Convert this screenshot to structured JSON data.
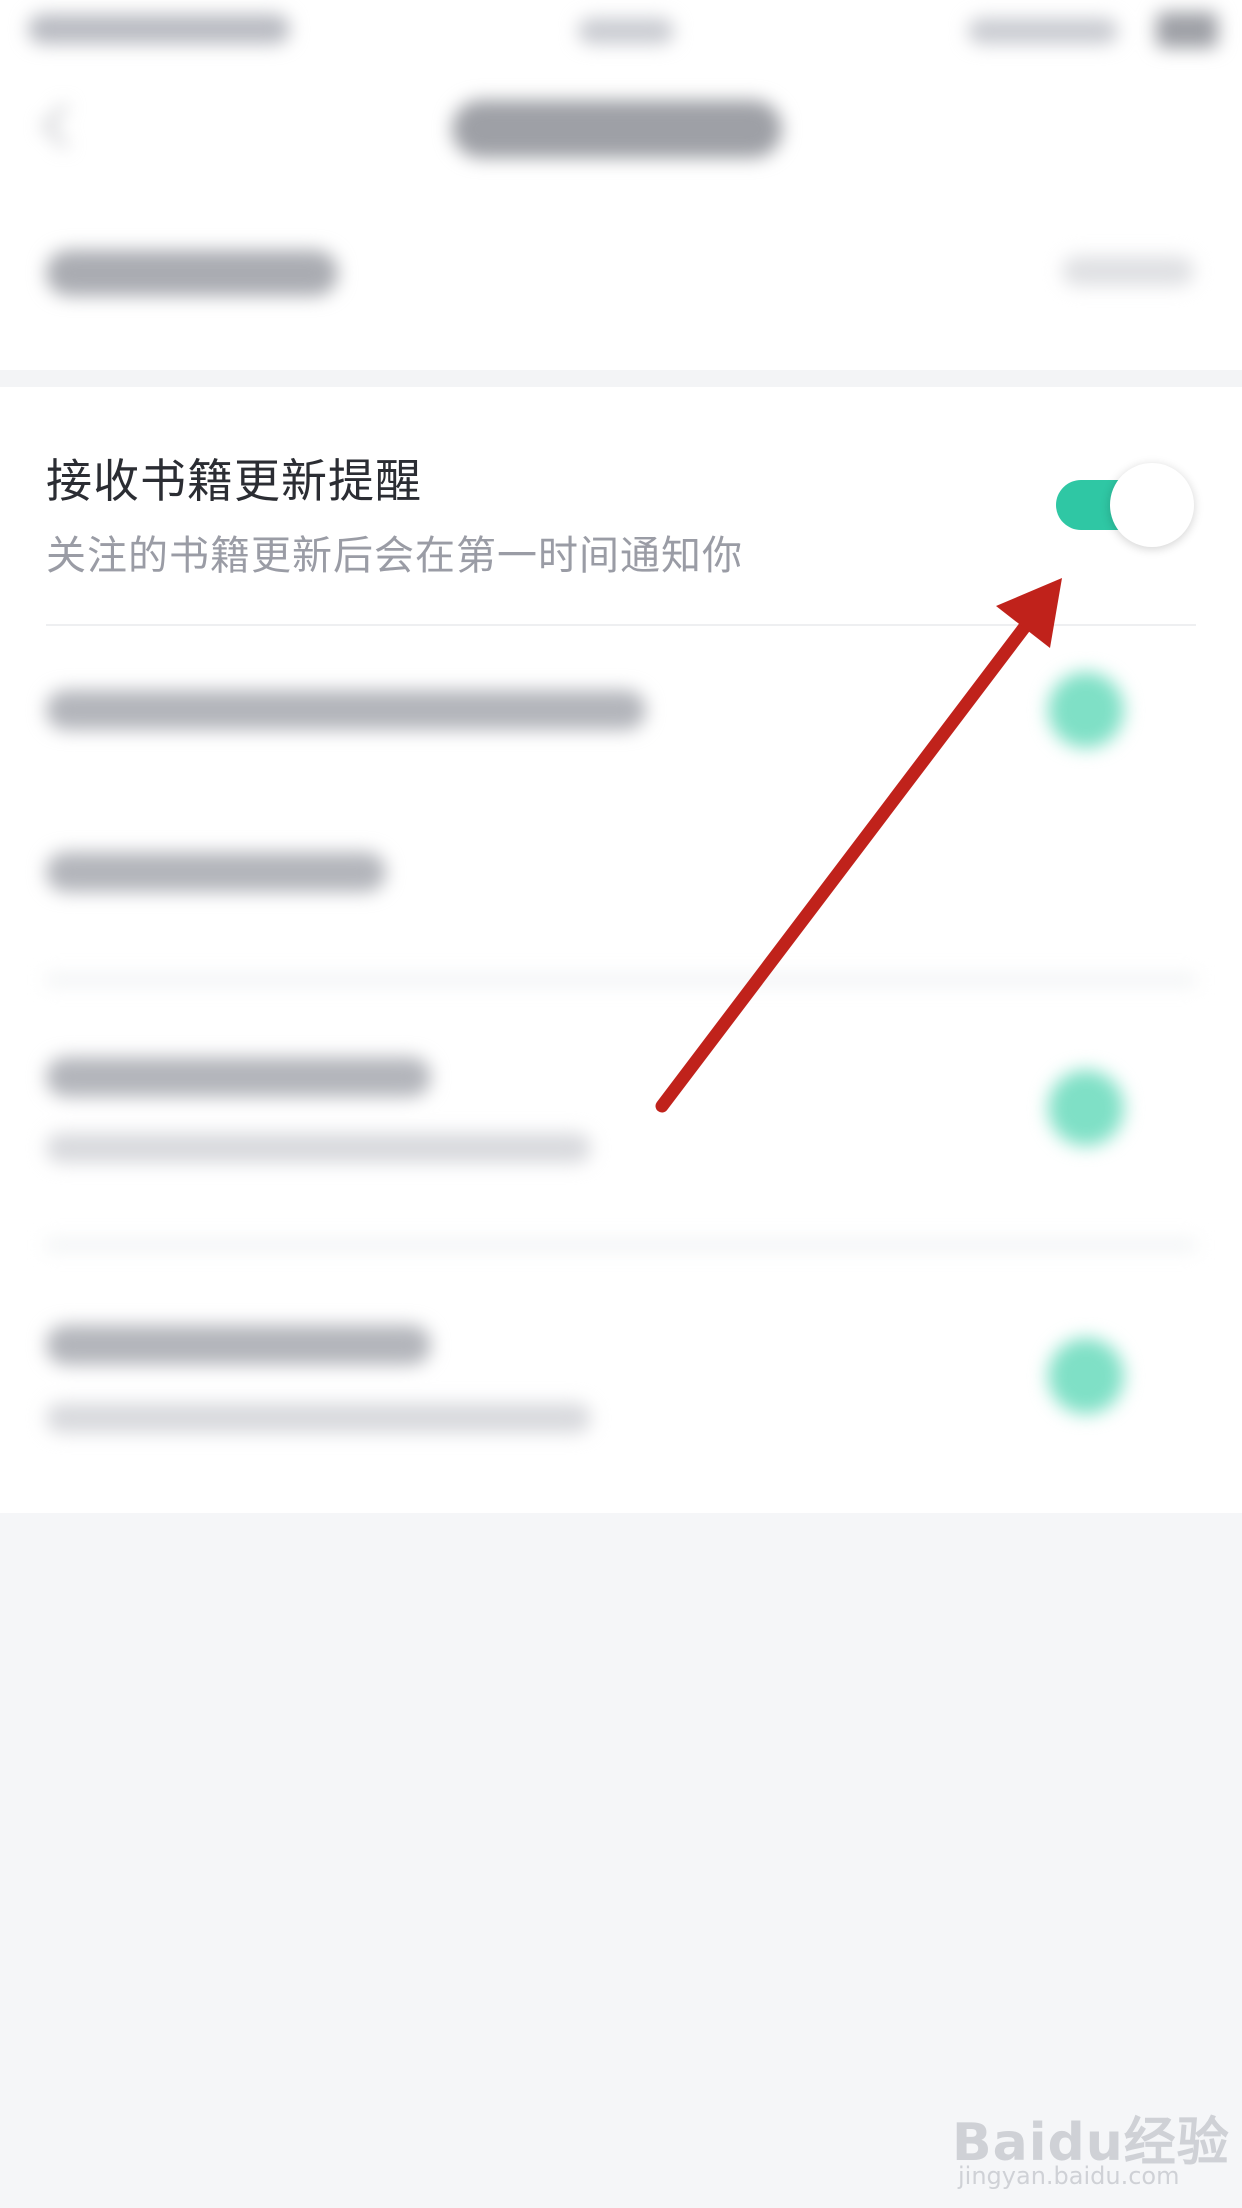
{
  "setting": {
    "title": "接收书籍更新提醒",
    "subtitle": "关注的书籍更新后会在第一时间通知你",
    "toggle_on": true
  },
  "colors": {
    "accent": "#2fc7a4",
    "arrow": "#c0221b",
    "background": "#f5f6f8"
  },
  "watermark": {
    "logo": "Baidu经验",
    "url": "jingyan.baidu.com"
  }
}
